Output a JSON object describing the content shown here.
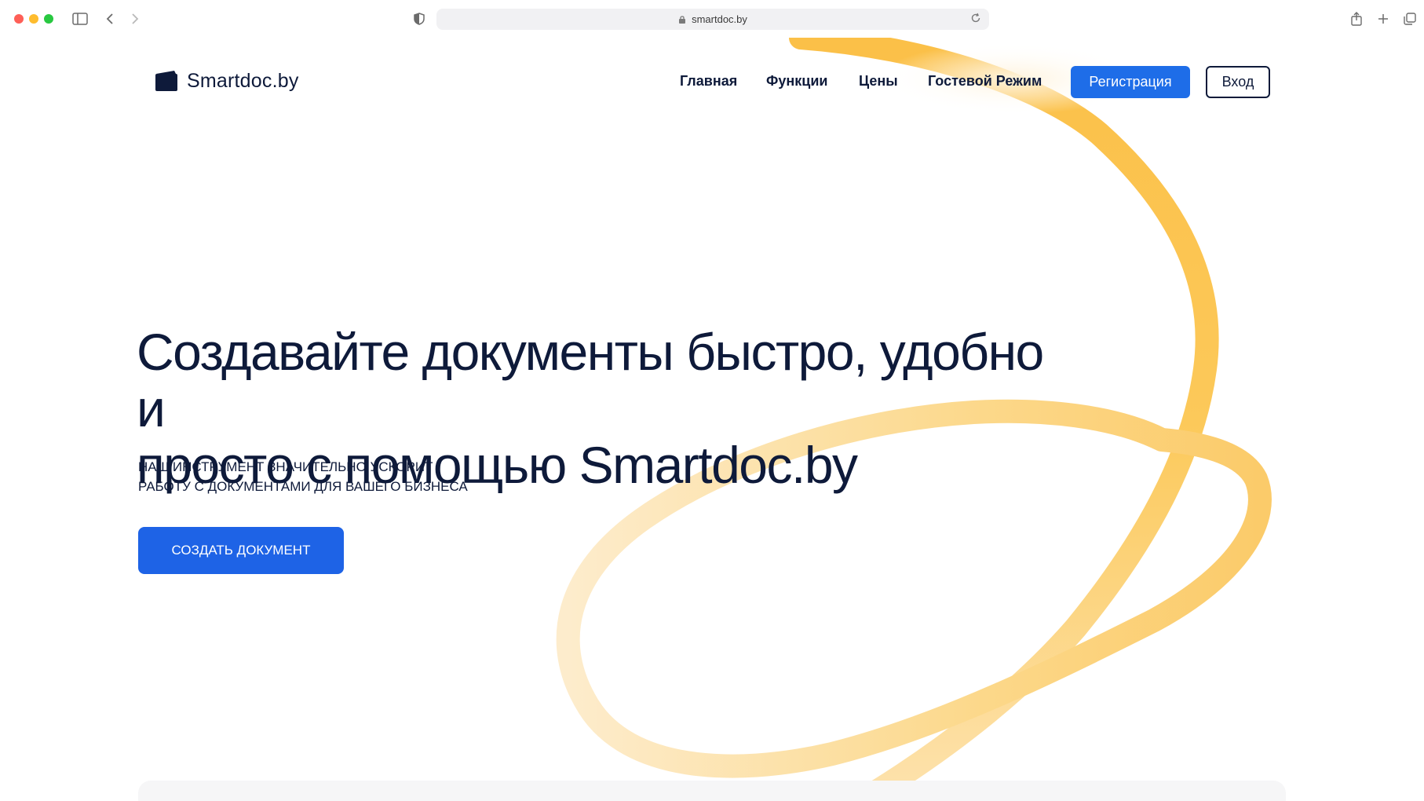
{
  "browser": {
    "url": "smartdoc.by"
  },
  "header": {
    "logo_text": "Smartdoc.by",
    "nav": [
      "Главная",
      "Функции",
      "Цены",
      "Гостевой Режим"
    ],
    "register_label": "Регистрация",
    "login_label": "Вход"
  },
  "hero": {
    "title_line1": "Создавайте документы быстро, удобно и",
    "title_line2": "просто с помощью Smartdoc.by",
    "subtitle_line1": "НАШ ИНСТРУМЕНТ ЗНАЧИТЕЛЬНО УСКОРИТ",
    "subtitle_line2": "РАБОТУ С ДОКУМЕНТАМИ ДЛЯ ВАШЕГО БИЗНЕСА",
    "cta_label": "СОЗДАТЬ ДОКУМЕНТ"
  },
  "colors": {
    "primary_blue": "#1e6de8",
    "dark_text": "#0e1a3a",
    "swirl_yellow": "#fbc048"
  }
}
